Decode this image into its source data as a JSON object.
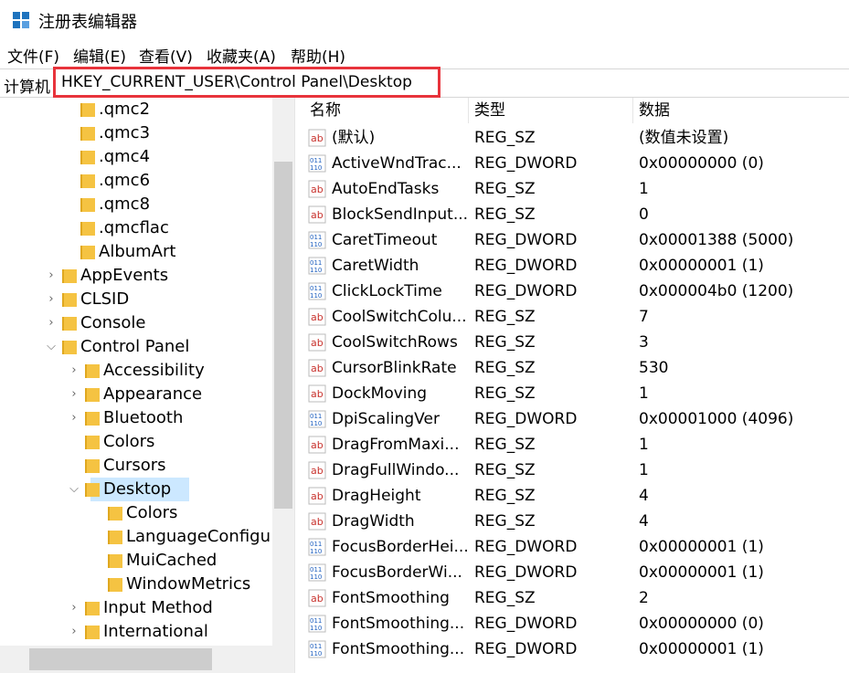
{
  "window": {
    "title": "注册表编辑器"
  },
  "menu": [
    "文件(F)",
    "编辑(E)",
    "查看(V)",
    "收藏夹(A)",
    "帮助(H)"
  ],
  "address": {
    "label": "计算机",
    "path": "HKEY_CURRENT_USER\\Control Panel\\Desktop"
  },
  "tree": [
    {
      "label": ".qmc2",
      "expander": "none"
    },
    {
      "label": ".qmc3",
      "expander": "none"
    },
    {
      "label": ".qmc4",
      "expander": "none"
    },
    {
      "label": ".qmc6",
      "expander": "none"
    },
    {
      "label": ".qmc8",
      "expander": "none"
    },
    {
      "label": ".qmcflac",
      "expander": "none"
    },
    {
      "label": "AlbumArt",
      "expander": "none"
    },
    {
      "label": "AppEvents",
      "expander": "collapsed"
    },
    {
      "label": "CLSID",
      "expander": "collapsed"
    },
    {
      "label": "Console",
      "expander": "collapsed"
    },
    {
      "label": "Control Panel",
      "expander": "expanded"
    },
    {
      "label": "Accessibility",
      "expander": "collapsed"
    },
    {
      "label": "Appearance",
      "expander": "collapsed"
    },
    {
      "label": "Bluetooth",
      "expander": "collapsed"
    },
    {
      "label": "Colors",
      "expander": "none"
    },
    {
      "label": "Cursors",
      "expander": "none"
    },
    {
      "label": "Desktop",
      "expander": "expanded",
      "selected": true
    },
    {
      "label": "Colors",
      "expander": "none"
    },
    {
      "label": "LanguageConfigu",
      "expander": "none"
    },
    {
      "label": "MuiCached",
      "expander": "none"
    },
    {
      "label": "WindowMetrics",
      "expander": "none"
    },
    {
      "label": "Input Method",
      "expander": "collapsed"
    },
    {
      "label": "International",
      "expander": "collapsed"
    }
  ],
  "columns": {
    "name": "名称",
    "type": "类型",
    "data": "数据"
  },
  "values": [
    {
      "icon": "string-value-icon",
      "name": "(默认)",
      "type": "REG_SZ",
      "data": "(数值未设置)"
    },
    {
      "icon": "dword-value-icon",
      "name": "ActiveWndTrac...",
      "type": "REG_DWORD",
      "data": "0x00000000 (0)"
    },
    {
      "icon": "string-value-icon",
      "name": "AutoEndTasks",
      "type": "REG_SZ",
      "data": "1"
    },
    {
      "icon": "string-value-icon",
      "name": "BlockSendInput...",
      "type": "REG_SZ",
      "data": "0"
    },
    {
      "icon": "dword-value-icon",
      "name": "CaretTimeout",
      "type": "REG_DWORD",
      "data": "0x00001388 (5000)"
    },
    {
      "icon": "dword-value-icon",
      "name": "CaretWidth",
      "type": "REG_DWORD",
      "data": "0x00000001 (1)"
    },
    {
      "icon": "dword-value-icon",
      "name": "ClickLockTime",
      "type": "REG_DWORD",
      "data": "0x000004b0 (1200)"
    },
    {
      "icon": "string-value-icon",
      "name": "CoolSwitchColu...",
      "type": "REG_SZ",
      "data": "7"
    },
    {
      "icon": "string-value-icon",
      "name": "CoolSwitchRows",
      "type": "REG_SZ",
      "data": "3"
    },
    {
      "icon": "string-value-icon",
      "name": "CursorBlinkRate",
      "type": "REG_SZ",
      "data": "530"
    },
    {
      "icon": "string-value-icon",
      "name": "DockMoving",
      "type": "REG_SZ",
      "data": "1"
    },
    {
      "icon": "dword-value-icon",
      "name": "DpiScalingVer",
      "type": "REG_DWORD",
      "data": "0x00001000 (4096)"
    },
    {
      "icon": "string-value-icon",
      "name": "DragFromMaxi...",
      "type": "REG_SZ",
      "data": "1"
    },
    {
      "icon": "string-value-icon",
      "name": "DragFullWindo...",
      "type": "REG_SZ",
      "data": "1"
    },
    {
      "icon": "string-value-icon",
      "name": "DragHeight",
      "type": "REG_SZ",
      "data": "4"
    },
    {
      "icon": "string-value-icon",
      "name": "DragWidth",
      "type": "REG_SZ",
      "data": "4"
    },
    {
      "icon": "dword-value-icon",
      "name": "FocusBorderHei...",
      "type": "REG_DWORD",
      "data": "0x00000001 (1)"
    },
    {
      "icon": "dword-value-icon",
      "name": "FocusBorderWi...",
      "type": "REG_DWORD",
      "data": "0x00000001 (1)"
    },
    {
      "icon": "string-value-icon",
      "name": "FontSmoothing",
      "type": "REG_SZ",
      "data": "2"
    },
    {
      "icon": "dword-value-icon",
      "name": "FontSmoothing...",
      "type": "REG_DWORD",
      "data": "0x00000000 (0)"
    },
    {
      "icon": "dword-value-icon",
      "name": "FontSmoothing...",
      "type": "REG_DWORD",
      "data": "0x00000001 (1)"
    }
  ],
  "colors": {
    "highlight": "#e8333b",
    "selection": "#cce8ff",
    "folder": "#f5c342"
  }
}
